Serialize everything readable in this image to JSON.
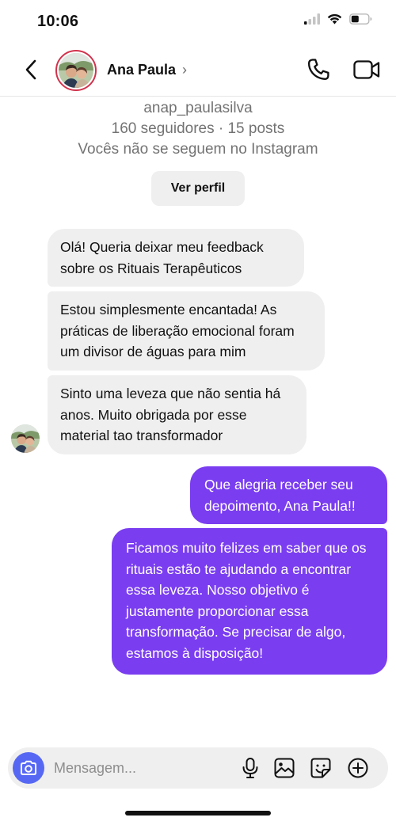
{
  "status_bar": {
    "time": "10:06",
    "icons": [
      "signal-icon",
      "wifi-icon",
      "battery-icon"
    ],
    "battery_level_fraction": 0.45
  },
  "header": {
    "name": "Ana Paula",
    "chevron": "›",
    "icons": [
      "chevron-left-icon",
      "phone-icon",
      "video-icon"
    ],
    "avatar_ring_color": "#d1334d"
  },
  "profile": {
    "username": "anap_paulasilva",
    "stats": "160 seguidores · 15 posts",
    "follow_status": "Vocês não se seguem no Instagram",
    "view_profile_label": "Ver perfil"
  },
  "messages": [
    {
      "sender": "Ana Paula",
      "text": "Olá! Queria deixar meu feedback sobre os Rituais Terapêuticos"
    },
    {
      "sender": "Ana Paula",
      "text": " Estou simplesmente encantada! As práticas de liberação emocional foram um divisor de águas para mim"
    },
    {
      "sender": "Ana Paula",
      "text": " Sinto uma leveza que não sentia há anos. Muito obrigada por esse material tao transformador"
    },
    {
      "sender": "me",
      "text": "Que alegria receber seu depoimento, Ana Paula!!"
    },
    {
      "sender": "me",
      "text": " Ficamos muito felizes em saber que os rituais estão te ajudando a encontrar essa leveza. Nosso objetivo é justamente proporcionar essa transformação. Se precisar de algo, estamos à disposição!"
    }
  ],
  "composer": {
    "placeholder": "Mensagem...",
    "value": "",
    "icons": [
      "camera-icon",
      "microphone-icon",
      "gallery-icon",
      "sticker-icon",
      "plus-circle-icon"
    ]
  },
  "colors": {
    "outgoing_bubble": "#7a3df0",
    "incoming_bubble": "#efefef",
    "camera_button": "#5668f3",
    "secondary_text": "#737373"
  }
}
